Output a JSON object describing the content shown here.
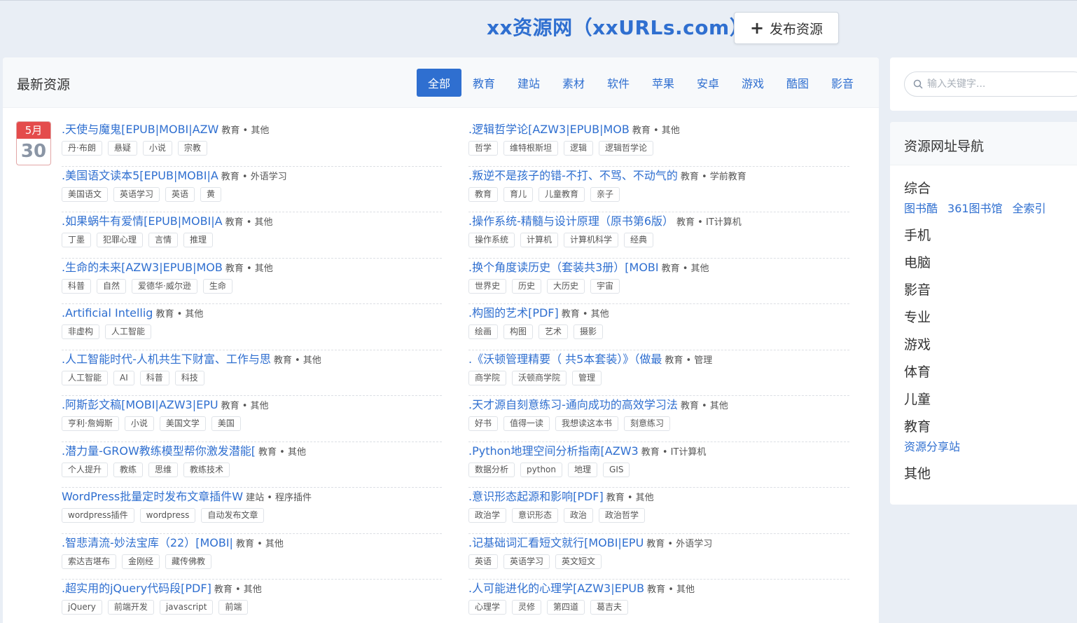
{
  "header": {
    "site_title": "xx资源网（xxURLs.com）",
    "publish_button": "发布资源"
  },
  "main": {
    "title": "最新资源",
    "tabs": [
      "全部",
      "教育",
      "建站",
      "素材",
      "软件",
      "苹果",
      "安卓",
      "游戏",
      "酷图",
      "影音"
    ],
    "active_tab": "全部",
    "date": {
      "month": "5月",
      "day": "30"
    },
    "left_items": [
      {
        "title": ".天使与魔鬼[EPUB|MOBI|AZW",
        "meta": "教育 • 其他",
        "tags": [
          "丹·布朗",
          "悬疑",
          "小说",
          "宗教"
        ]
      },
      {
        "title": ".美国语文读本5[EPUB|MOBI|A",
        "meta": "教育 • 外语学习",
        "tags": [
          "美国语文",
          "英语学习",
          "英语",
          "黄"
        ]
      },
      {
        "title": ".如果蜗牛有爱情[EPUB|MOBI|A",
        "meta": "教育 • 其他",
        "tags": [
          "丁墨",
          "犯罪心理",
          "言情",
          "推理"
        ]
      },
      {
        "title": ".生命的未来[AZW3|EPUB|MOB",
        "meta": "教育 • 其他",
        "tags": [
          "科普",
          "自然",
          "爱德华·威尔逊",
          "生命"
        ]
      },
      {
        "title": ".Artificial Intellig",
        "meta": "教育 • 其他",
        "tags": [
          "非虚构",
          "人工智能"
        ]
      },
      {
        "title": ".人工智能时代-人机共生下财富、工作与思",
        "meta": "教育 • 其他",
        "tags": [
          "人工智能",
          "AI",
          "科普",
          "科技"
        ]
      },
      {
        "title": ".阿斯彭文稿[MOBI|AZW3|EPU",
        "meta": "教育 • 其他",
        "tags": [
          "亨利·詹姆斯",
          "小说",
          "美国文学",
          "美国"
        ]
      },
      {
        "title": ".潜力量-GROW教练模型帮你激发潜能[",
        "meta": "教育 • 其他",
        "tags": [
          "个人提升",
          "教练",
          "思维",
          "教练技术"
        ]
      },
      {
        "title": "WordPress批量定时发布文章插件W",
        "meta": "建站 • 程序插件",
        "tags": [
          "wordpress插件",
          "wordpress",
          "自动发布文章"
        ]
      },
      {
        "title": ".智悲清流-妙法宝库（22）[MOBI|",
        "meta": "教育 • 其他",
        "tags": [
          "索达吉堪布",
          "金刚经",
          "藏传佛教"
        ]
      },
      {
        "title": ".超实用的jQuery代码段[PDF]",
        "meta": "教育 • 其他",
        "tags": [
          "jQuery",
          "前端开发",
          "javascript",
          "前端"
        ]
      }
    ],
    "right_items": [
      {
        "title": ".逻辑哲学论[AZW3|EPUB|MOB",
        "meta": "教育 • 其他",
        "tags": [
          "哲学",
          "维特根斯坦",
          "逻辑",
          "逻辑哲学论"
        ]
      },
      {
        "title": ".叛逆不是孩子的错-不打、不骂、不动气的",
        "meta": "教育 • 学前教育",
        "tags": [
          "教育",
          "育儿",
          "儿童教育",
          "亲子"
        ]
      },
      {
        "title": ".操作系统-精髓与设计原理（原书第6版）",
        "meta": "教育 • IT计算机",
        "tags": [
          "操作系统",
          "计算机",
          "计算机科学",
          "经典"
        ]
      },
      {
        "title": ".换个角度读历史（套装共3册）[MOBI",
        "meta": "教育 • 其他",
        "tags": [
          "世界史",
          "历史",
          "大历史",
          "宇宙"
        ]
      },
      {
        "title": ".构图的艺术[PDF]",
        "meta": "教育 • 其他",
        "tags": [
          "绘画",
          "构图",
          "艺术",
          "摄影"
        ]
      },
      {
        "title": ".《沃顿管理精要（ 共5本套装）》（做最",
        "meta": "教育 • 管理",
        "tags": [
          "商学院",
          "沃顿商学院",
          "管理"
        ]
      },
      {
        "title": ".天才源自刻意练习-通向成功的高效学习法",
        "meta": "教育 • 其他",
        "tags": [
          "好书",
          "值得一读",
          "我想读这本书",
          "刻意练习"
        ]
      },
      {
        "title": ".Python地理空间分析指南[AZW3",
        "meta": "教育 • IT计算机",
        "tags": [
          "数据分析",
          "python",
          "地理",
          "GIS"
        ]
      },
      {
        "title": ".意识形态起源和影响[PDF]",
        "meta": "教育 • 其他",
        "tags": [
          "政治学",
          "意识形态",
          "政治",
          "政治哲学"
        ]
      },
      {
        "title": ".记基础词汇看短文就行[MOBI|EPU",
        "meta": "教育 • 外语学习",
        "tags": [
          "英语",
          "英语学习",
          "英文短文"
        ]
      },
      {
        "title": ".人可能进化的心理学[AZW3|EPUB",
        "meta": "教育 • 其他",
        "tags": [
          "心理学",
          "灵修",
          "第四道",
          "葛吉夫"
        ]
      }
    ]
  },
  "search": {
    "placeholder": "输入关键字..."
  },
  "nav": {
    "title": "资源网址导航",
    "categories": [
      {
        "name": "综合",
        "links": [
          "图书酷",
          "361图书馆",
          "全索引"
        ]
      },
      {
        "name": "手机",
        "links": []
      },
      {
        "name": "电脑",
        "links": []
      },
      {
        "name": "影音",
        "links": []
      },
      {
        "name": "专业",
        "links": []
      },
      {
        "name": "游戏",
        "links": []
      },
      {
        "name": "体育",
        "links": []
      },
      {
        "name": "儿童",
        "links": []
      },
      {
        "name": "教育",
        "links": [
          "资源分享站"
        ]
      },
      {
        "name": "其他",
        "links": []
      }
    ]
  },
  "colors": {
    "accent": "#2f6fd0",
    "date_red": "#e44b4b",
    "background": "#e9eef5"
  },
  "icons": {
    "publish": "plus-icon",
    "search": "search-icon"
  }
}
